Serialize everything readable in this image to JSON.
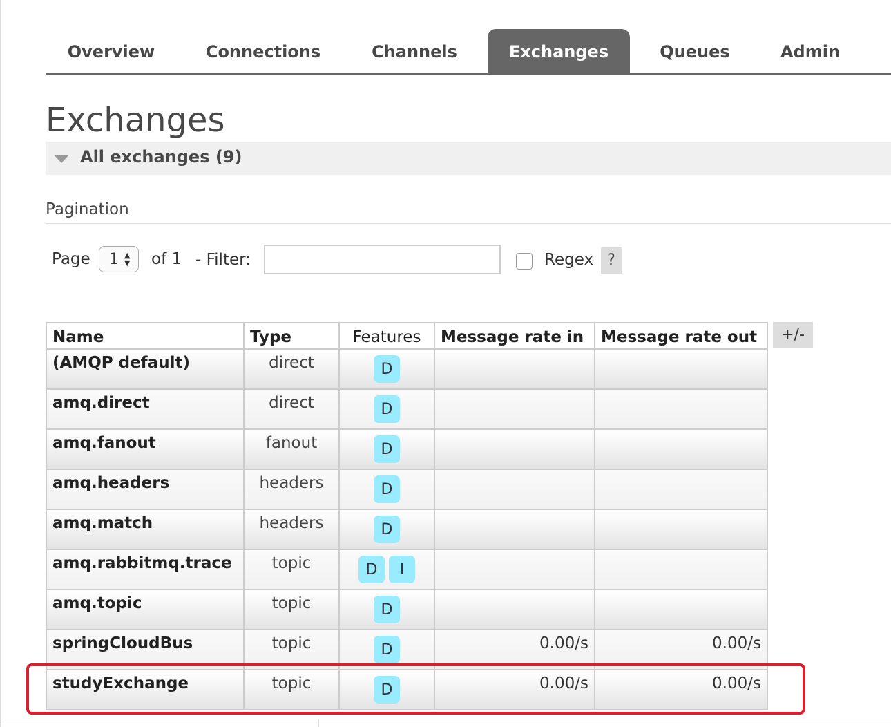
{
  "nav": {
    "tabs": [
      {
        "label": "Overview",
        "active": false
      },
      {
        "label": "Connections",
        "active": false
      },
      {
        "label": "Channels",
        "active": false
      },
      {
        "label": "Exchanges",
        "active": true
      },
      {
        "label": "Queues",
        "active": false
      },
      {
        "label": "Admin",
        "active": false
      }
    ]
  },
  "page": {
    "title": "Exchanges",
    "section_title": "All exchanges (9)"
  },
  "pagination": {
    "label": "Pagination",
    "page_label": "Page",
    "current_page": "1",
    "of_label": "of 1",
    "filter_label": "- Filter:",
    "filter_value": "",
    "regex_label": "Regex",
    "regex_checked": false,
    "help_label": "?"
  },
  "table": {
    "headers": [
      "Name",
      "Type",
      "Features",
      "Message rate in",
      "Message rate out"
    ],
    "columns_toggle": "+/-",
    "rows": [
      {
        "name": "(AMQP default)",
        "type": "direct",
        "features": [
          "D"
        ],
        "rate_in": "",
        "rate_out": ""
      },
      {
        "name": "amq.direct",
        "type": "direct",
        "features": [
          "D"
        ],
        "rate_in": "",
        "rate_out": ""
      },
      {
        "name": "amq.fanout",
        "type": "fanout",
        "features": [
          "D"
        ],
        "rate_in": "",
        "rate_out": ""
      },
      {
        "name": "amq.headers",
        "type": "headers",
        "features": [
          "D"
        ],
        "rate_in": "",
        "rate_out": ""
      },
      {
        "name": "amq.match",
        "type": "headers",
        "features": [
          "D"
        ],
        "rate_in": "",
        "rate_out": ""
      },
      {
        "name": "amq.rabbitmq.trace",
        "type": "topic",
        "features": [
          "D",
          "I"
        ],
        "rate_in": "",
        "rate_out": ""
      },
      {
        "name": "amq.topic",
        "type": "topic",
        "features": [
          "D"
        ],
        "rate_in": "",
        "rate_out": ""
      },
      {
        "name": "springCloudBus",
        "type": "topic",
        "features": [
          "D"
        ],
        "rate_in": "0.00/s",
        "rate_out": "0.00/s"
      },
      {
        "name": "studyExchange",
        "type": "topic",
        "features": [
          "D"
        ],
        "rate_in": "0.00/s",
        "rate_out": "0.00/s"
      }
    ]
  },
  "colors": {
    "active_tab": "#666666",
    "badge": "#99ebff",
    "highlight": "#d9202c"
  }
}
